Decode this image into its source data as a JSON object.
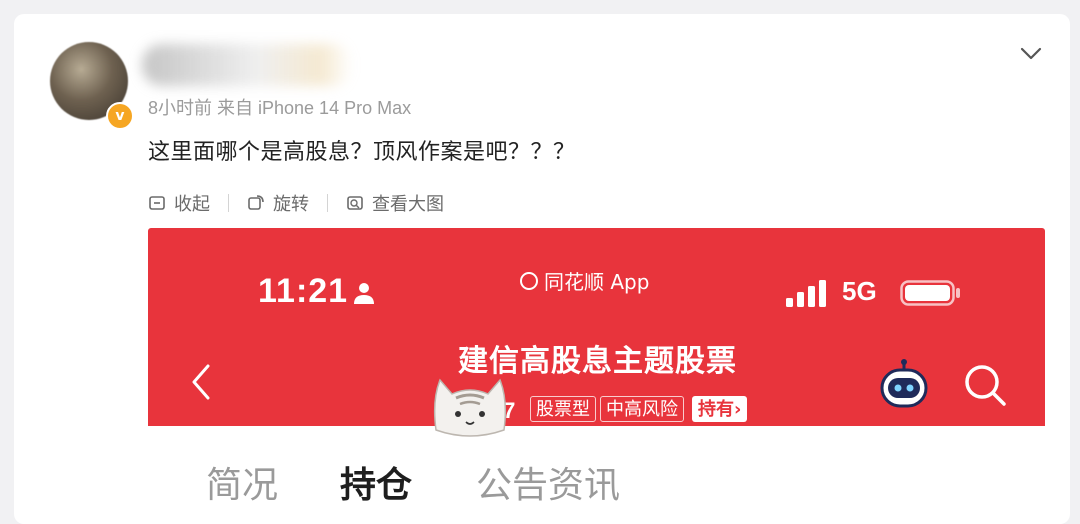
{
  "post": {
    "meta": "8小时前 来自 iPhone 14 Pro Max",
    "verified_badge": "v",
    "text": "这里面哪个是高股息？顶风作案是吧？？？"
  },
  "actions": {
    "collapse": "收起",
    "rotate": "旋转",
    "view_large": "查看大图"
  },
  "screenshot": {
    "status": {
      "time": "11:21",
      "app": "同花顺 App",
      "network": "5G"
    },
    "fund": {
      "title": "建信高股息主题股票",
      "code": "000177",
      "tags": [
        "股票型",
        "中高风险"
      ],
      "hold_label": "持有",
      "hold_arrow": "›"
    },
    "tabs": [
      {
        "label": "简况",
        "active": false
      },
      {
        "label": "持仓",
        "active": true
      },
      {
        "label": "公告资讯",
        "active": false
      }
    ]
  },
  "colors": {
    "accent_red": "#e8343c",
    "badge_orange": "#f6a623",
    "text_main": "#222222",
    "text_muted": "#9b9b9b"
  },
  "icons": [
    "chevron-down-icon",
    "collapse-icon",
    "rotate-icon",
    "view-large-icon",
    "person-icon",
    "signal-icon",
    "battery-icon",
    "back-icon",
    "robot-icon",
    "search-icon",
    "cat-sticker"
  ]
}
